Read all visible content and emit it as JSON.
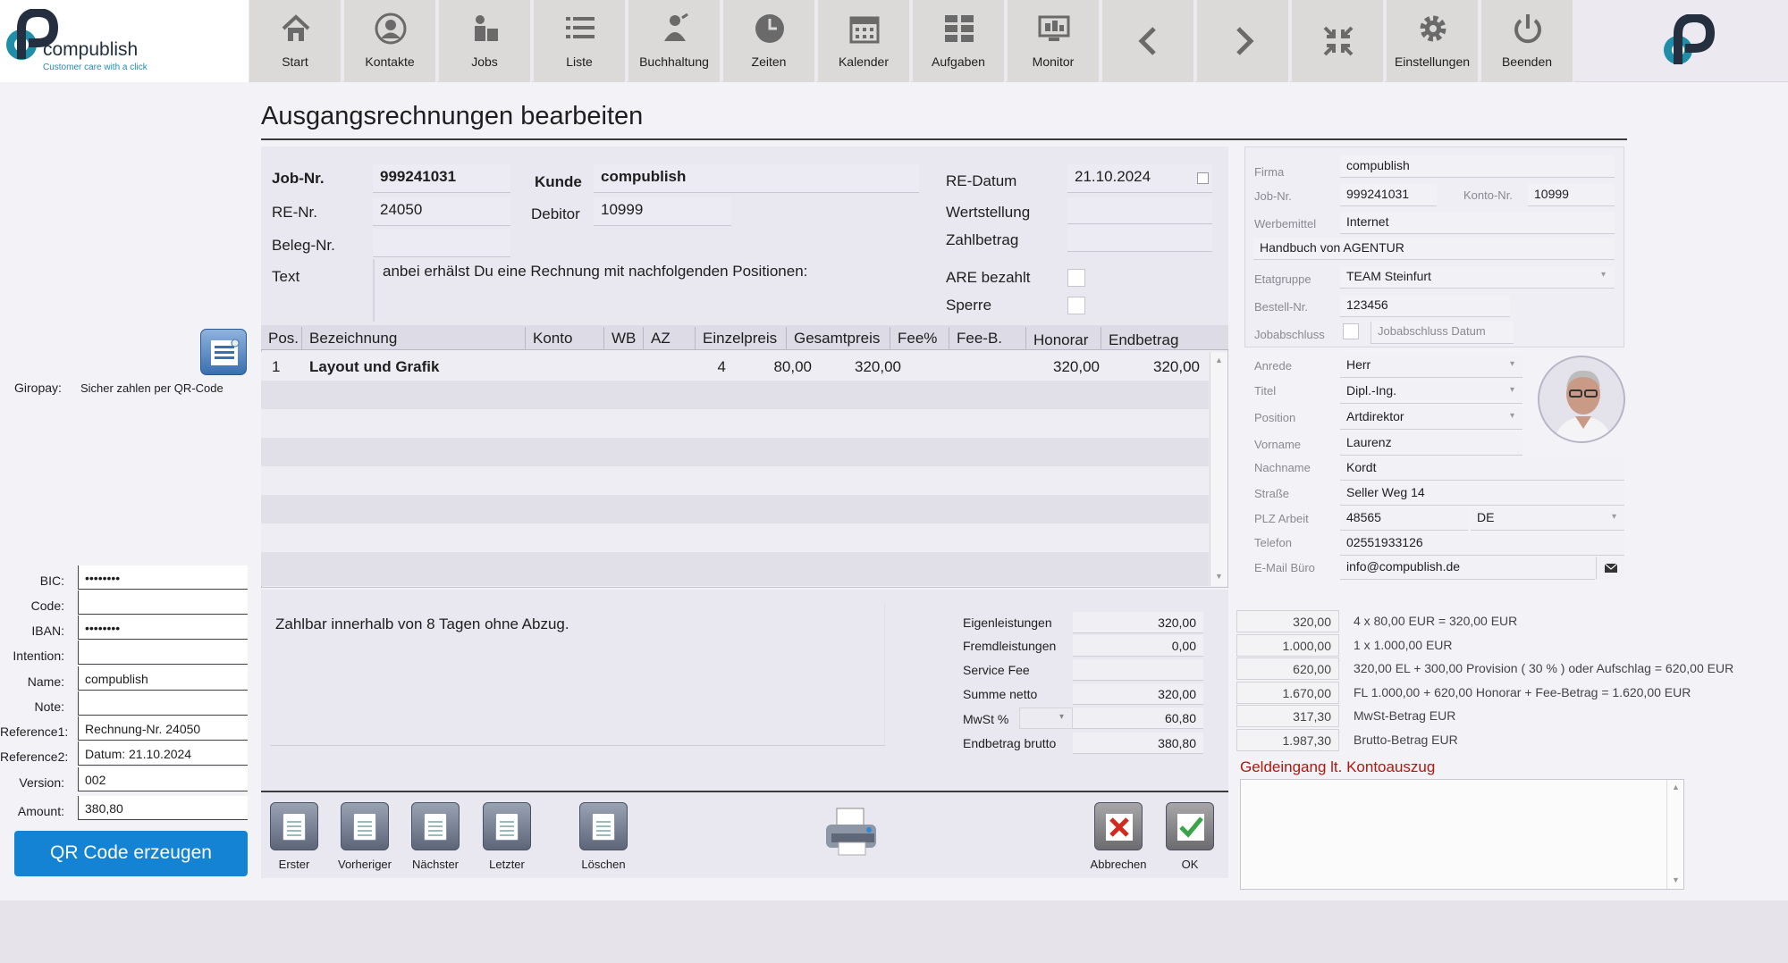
{
  "brand": {
    "name": "compublish",
    "tagline": "Customer care with a click"
  },
  "toolbar": {
    "buttons": [
      {
        "label": "Start",
        "icon": "home-icon"
      },
      {
        "label": "Kontakte",
        "icon": "person-icon"
      },
      {
        "label": "Jobs",
        "icon": "job-icon"
      },
      {
        "label": "Liste",
        "icon": "list-icon"
      },
      {
        "label": "Buchhaltung",
        "icon": "accounting-icon"
      },
      {
        "label": "Zeiten",
        "icon": "clock-icon"
      },
      {
        "label": "Kalender",
        "icon": "calendar-icon"
      },
      {
        "label": "Aufgaben",
        "icon": "tasks-icon"
      },
      {
        "label": "Monitor",
        "icon": "monitor-icon"
      },
      {
        "label": "",
        "icon": "chevron-left-icon"
      },
      {
        "label": "",
        "icon": "chevron-right-icon"
      },
      {
        "label": "",
        "icon": "collapse-icon"
      },
      {
        "label": "Einstellungen",
        "icon": "gear-icon"
      },
      {
        "label": "Beenden",
        "icon": "power-icon"
      }
    ]
  },
  "page": {
    "title": "Ausgangsrechnungen bearbeiten"
  },
  "header": {
    "job_nr_label": "Job-Nr.",
    "job_nr": "999241031",
    "kunde_label": "Kunde",
    "kunde": "compublish",
    "re_nr_label": "RE-Nr.",
    "re_nr": "24050",
    "debitor_label": "Debitor",
    "debitor": "10999",
    "beleg_nr_label": "Beleg-Nr.",
    "beleg_nr": "",
    "text_label": "Text",
    "text": "anbei erhälst Du eine Rechnung mit nachfolgenden Positionen:",
    "re_datum_label": "RE-Datum",
    "re_datum": "21.10.2024",
    "wertstellung_label": "Wertstellung",
    "wertstellung": "",
    "zahlbetrag_label": "Zahlbetrag",
    "zahlbetrag": "",
    "are_bezahlt_label": "ARE bezahlt",
    "sperre_label": "Sperre"
  },
  "table": {
    "columns": [
      "Pos.",
      "Bezeichnung",
      "Konto",
      "WB",
      "AZ",
      "Einzelpreis",
      "Gesamtpreis",
      "Fee%",
      "Fee-B.",
      "Honorar",
      "Endbetrag"
    ],
    "rows": [
      {
        "pos": "1",
        "bezeichnung": "Layout und Grafik",
        "konto": "",
        "wb": "",
        "az": "4",
        "einzelpreis": "80,00",
        "gesamtpreis": "320,00",
        "fee_pct": "",
        "fee_b": "",
        "honorar": "320,00",
        "endbetrag": "320,00"
      }
    ]
  },
  "payment_note": "Zahlbar innerhalb von 8 Tagen ohne Abzug.",
  "summary": {
    "eigen_label": "Eigenleistungen",
    "eigen": "320,00",
    "fremd_label": "Fremdleistungen",
    "fremd": "0,00",
    "fee_label": "Service Fee",
    "fee": "",
    "netto_label": "Summe netto",
    "netto": "320,00",
    "mwst_label": "MwSt %",
    "mwst": "60,80",
    "brutto_label": "Endbetrag brutto",
    "brutto": "380,80"
  },
  "calc": [
    {
      "value": "320,00",
      "text": "4 x 80,00 EUR = 320,00 EUR"
    },
    {
      "value": "1.000,00",
      "text": "1 x 1.000,00 EUR"
    },
    {
      "value": "620,00",
      "text": "320,00 EL + 300,00 Provision ( 30 % ) oder Aufschlag = 620,00 EUR"
    },
    {
      "value": "1.670,00",
      "text": "FL 1.000,00 + 620,00 Honorar + Fee-Betrag = 1.620,00 EUR"
    },
    {
      "value": "317,30",
      "text": "MwSt-Betrag EUR"
    },
    {
      "value": "1.987,30",
      "text": "Brutto-Betrag EUR"
    }
  ],
  "geldeingang": {
    "label": "Geldeingang lt. Kontoauszug",
    "value": ""
  },
  "right": {
    "firma_label": "Firma",
    "firma": "compublish",
    "job_label": "Job-Nr.",
    "job": "999241031",
    "konto_label": "Konto-Nr.",
    "konto": "10999",
    "werbe_label": "Werbemittel",
    "werbe": "Internet",
    "handbuch": "Handbuch von AGENTUR",
    "etat_label": "Etatgruppe",
    "etat": "TEAM Steinfurt",
    "bestell_label": "Bestell-Nr.",
    "bestell": "123456",
    "jobabschluss_label": "Jobabschluss",
    "jobabschluss_datum": "Jobabschluss Datum",
    "anrede_label": "Anrede",
    "anrede": "Herr",
    "titel_label": "Titel",
    "titel": "Dipl.-Ing.",
    "position_label": "Position",
    "position": "Artdirektor",
    "vorname_label": "Vorname",
    "vorname": "Laurenz",
    "nachname_label": "Nachname",
    "nachname": "Kordt",
    "strasse_label": "Straße",
    "strasse": "Seller Weg 14",
    "plz_label": "PLZ Arbeit",
    "plz": "48565",
    "land": "DE",
    "telefon_label": "Telefon",
    "telefon": "02551933126",
    "email_label": "E-Mail Büro",
    "email": "info@compublish.de"
  },
  "giropay": {
    "label": "Giropay:",
    "text": "Sicher zahlen per QR-Code",
    "fields": [
      {
        "label": "BIC:",
        "value": "••••••••"
      },
      {
        "label": "Code:",
        "value": ""
      },
      {
        "label": "IBAN:",
        "value": "••••••••"
      },
      {
        "label": "Intention:",
        "value": ""
      },
      {
        "label": "Name:",
        "value": "compublish"
      },
      {
        "label": "Note:",
        "value": ""
      },
      {
        "label": "Reference1:",
        "value": "Rechnung-Nr. 24050"
      },
      {
        "label": "Reference2:",
        "value": "Datum: 21.10.2024"
      },
      {
        "label": "Version:",
        "value": "002"
      },
      {
        "label": "Amount:",
        "value": "380,80"
      }
    ],
    "button": "QR Code erzeugen"
  },
  "nav": {
    "erster": "Erster",
    "vorheriger": "Vorheriger",
    "naechster": "Nächster",
    "letzter": "Letzter",
    "loeschen": "Löschen",
    "abbrechen": "Abbrechen",
    "ok": "OK"
  }
}
